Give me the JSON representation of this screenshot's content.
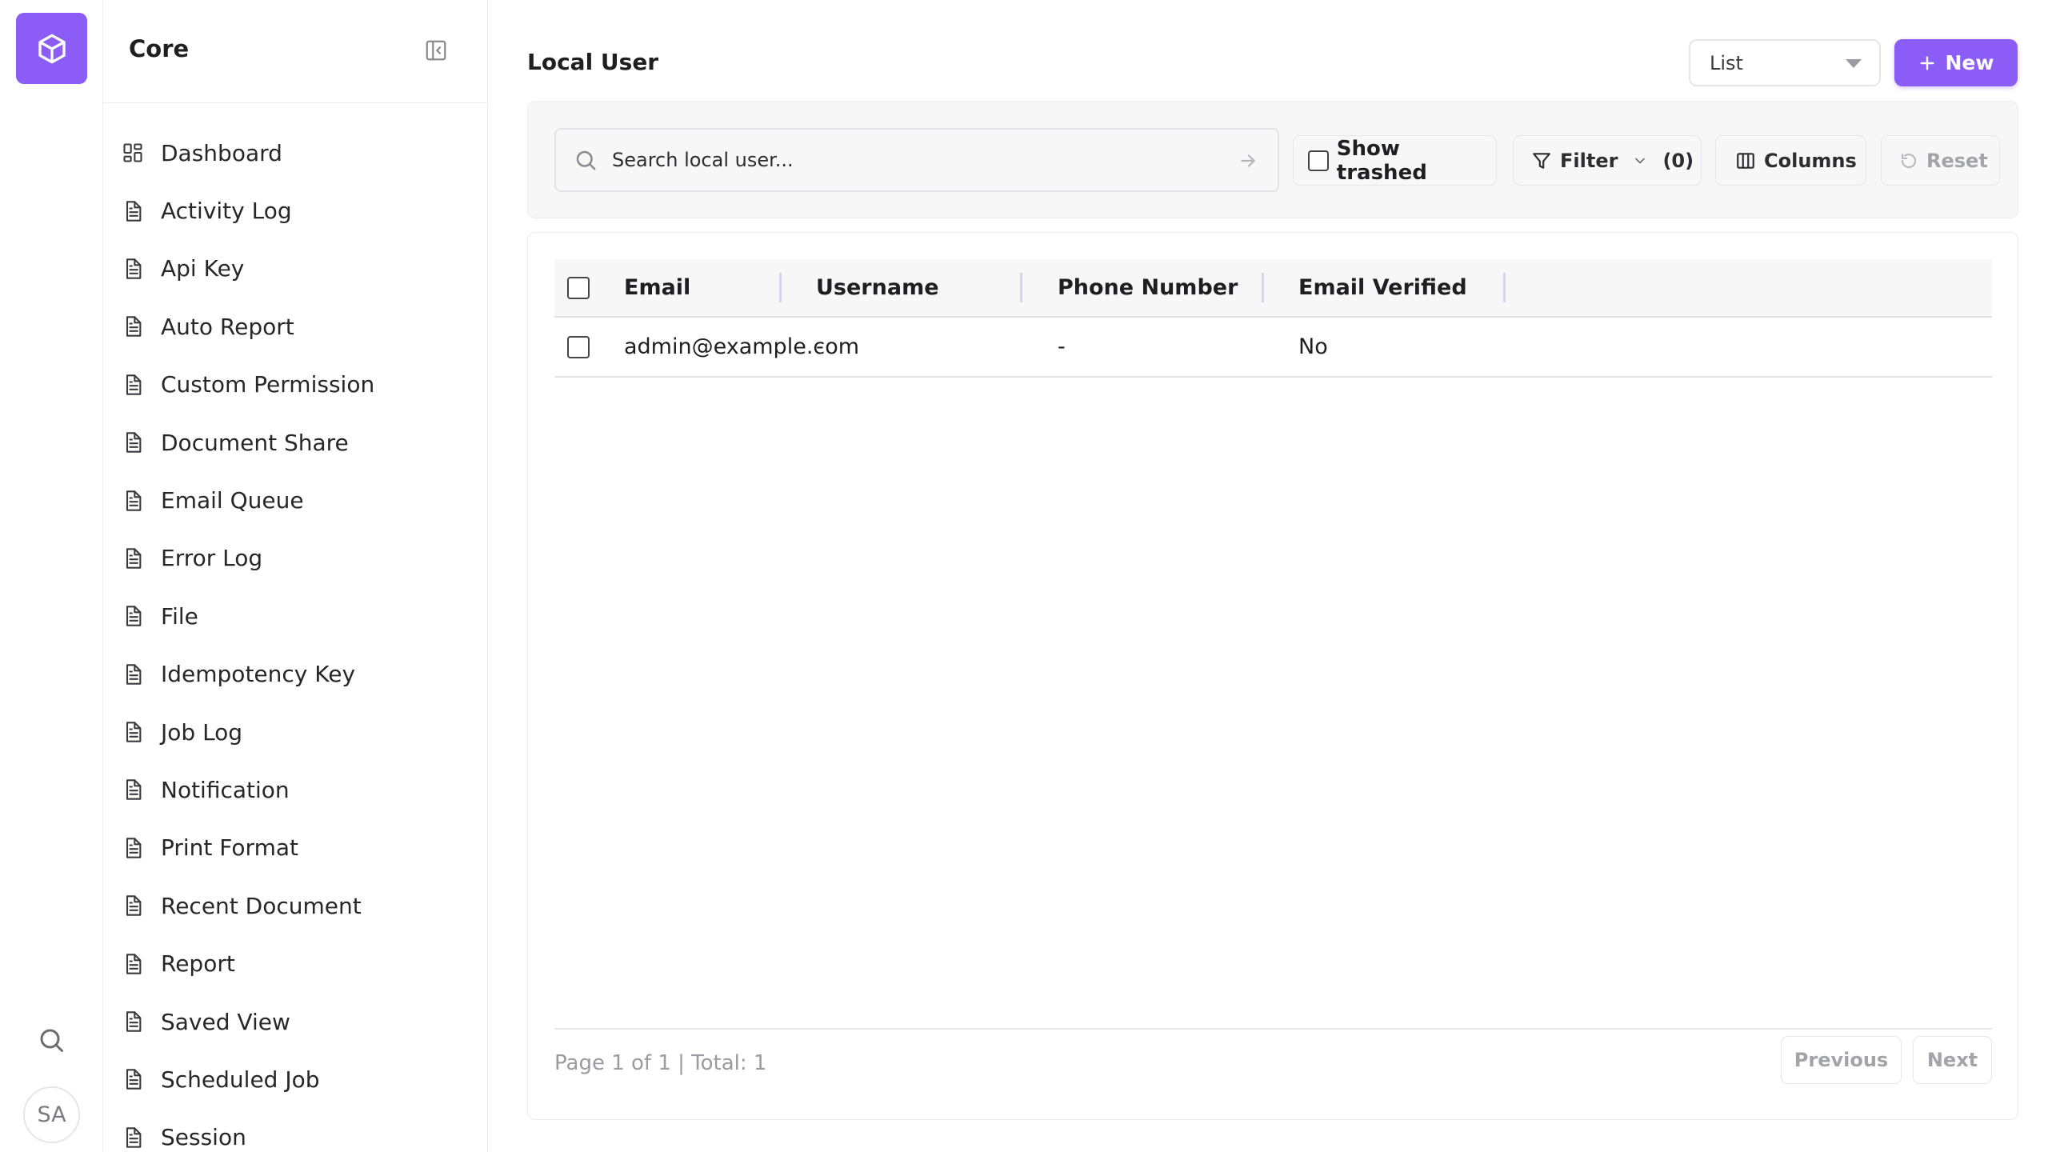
{
  "rail": {
    "logo_icon": "cube-icon",
    "search_icon": "search-icon",
    "avatar_initials": "SA"
  },
  "sidebar": {
    "title": "Core",
    "collapse_icon": "panel-collapse-icon",
    "items": [
      {
        "label": "Dashboard",
        "icon": "dashboard-icon"
      },
      {
        "label": "Activity Log",
        "icon": "document-icon"
      },
      {
        "label": "Api Key",
        "icon": "document-icon"
      },
      {
        "label": "Auto Report",
        "icon": "document-icon"
      },
      {
        "label": "Custom Permission",
        "icon": "document-icon"
      },
      {
        "label": "Document Share",
        "icon": "document-icon"
      },
      {
        "label": "Email Queue",
        "icon": "document-icon"
      },
      {
        "label": "Error Log",
        "icon": "document-icon"
      },
      {
        "label": "File",
        "icon": "document-icon"
      },
      {
        "label": "Idempotency Key",
        "icon": "document-icon"
      },
      {
        "label": "Job Log",
        "icon": "document-icon"
      },
      {
        "label": "Notification",
        "icon": "document-icon"
      },
      {
        "label": "Print Format",
        "icon": "document-icon"
      },
      {
        "label": "Recent Document",
        "icon": "document-icon"
      },
      {
        "label": "Report",
        "icon": "document-icon"
      },
      {
        "label": "Saved View",
        "icon": "document-icon"
      },
      {
        "label": "Scheduled Job",
        "icon": "document-icon"
      },
      {
        "label": "Session",
        "icon": "document-icon"
      }
    ]
  },
  "header": {
    "title": "Local User",
    "view_select": "List",
    "new_label": "New"
  },
  "toolbar": {
    "search_placeholder": "Search local user...",
    "show_trashed_label": "Show trashed",
    "filter_label": "Filter",
    "filter_count": "(0)",
    "columns_label": "Columns",
    "reset_label": "Reset"
  },
  "table": {
    "columns": [
      "Email",
      "Username",
      "Phone Number",
      "Email Verified"
    ],
    "rows": [
      [
        "admin@example.com",
        "-",
        "-",
        "No"
      ]
    ]
  },
  "pagination": {
    "summary": "Page 1 of 1 | Total: 1",
    "previous_label": "Previous",
    "next_label": "Next"
  },
  "colors": {
    "accent": "#8b5cf6",
    "border": "#ececef",
    "toolbar_bg": "#f7f7f8"
  }
}
